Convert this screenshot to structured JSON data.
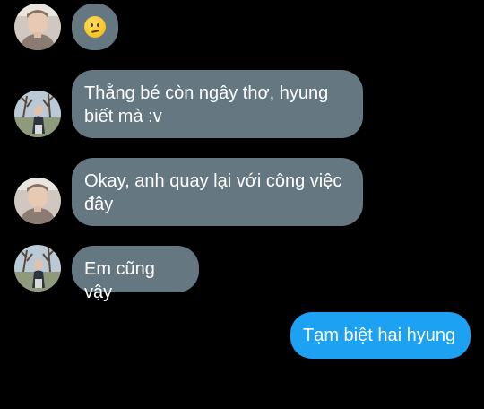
{
  "conversation": {
    "messages": [
      {
        "sender": "hyung-1",
        "direction": "incoming",
        "emoji": "confused-face-emoji"
      },
      {
        "sender": "hyung-2",
        "direction": "incoming",
        "text": "Thằng bé còn ngây thơ, hyung biết mà :v"
      },
      {
        "sender": "hyung-1",
        "direction": "incoming",
        "text": "Okay, anh quay lại với công việc đây"
      },
      {
        "sender": "hyung-2",
        "direction": "incoming",
        "text": "Em cũng vậy"
      },
      {
        "sender": "me",
        "direction": "outgoing",
        "text": "Tạm biệt hai hyung"
      }
    ]
  },
  "colors": {
    "background": "#000000",
    "incoming_bubble": "#657780",
    "outgoing_bubble": "#1da1f2",
    "text": "#ffffff"
  }
}
